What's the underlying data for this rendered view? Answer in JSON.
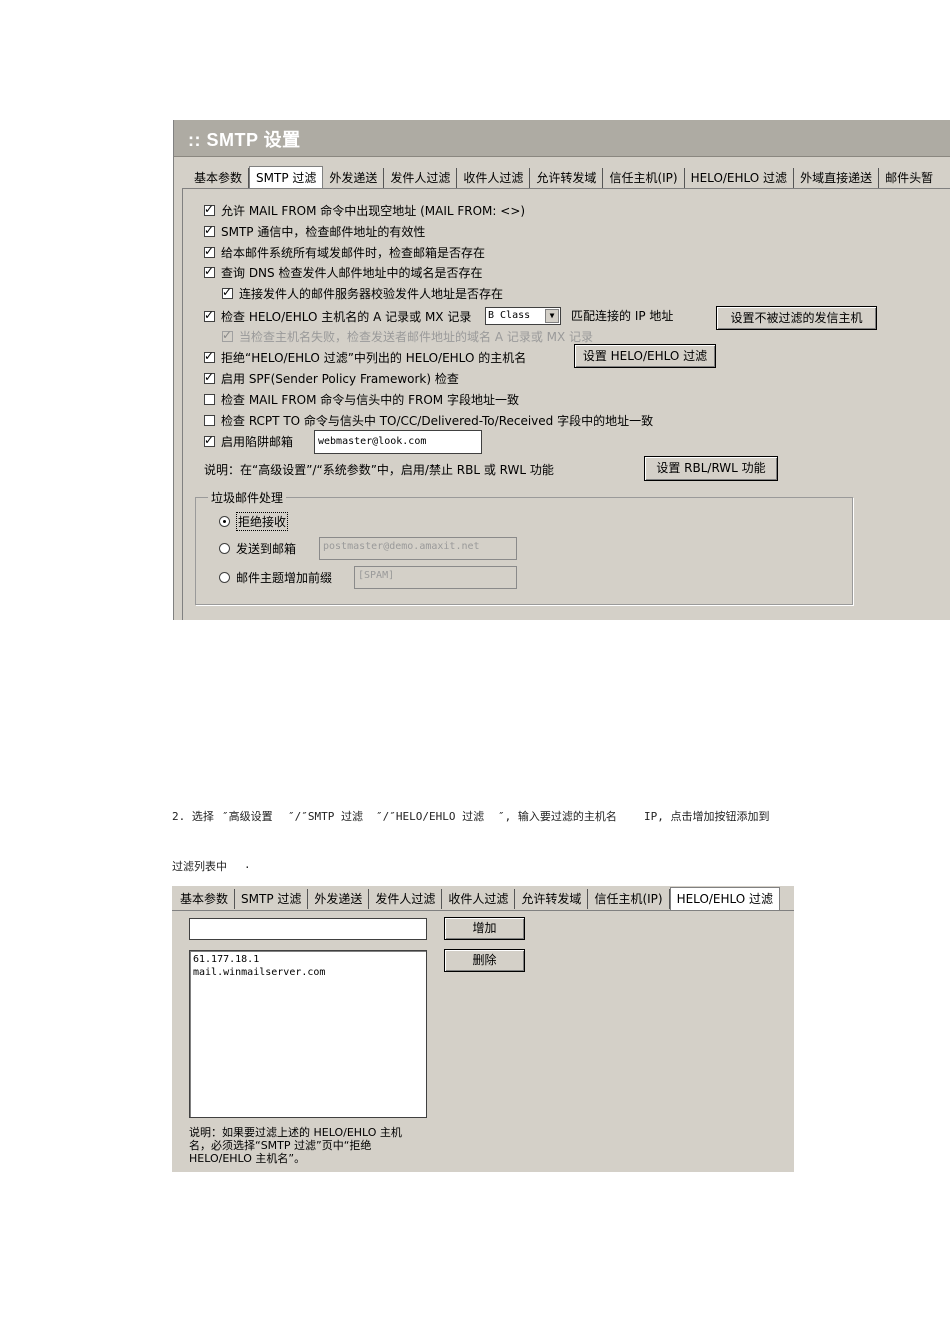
{
  "panel1": {
    "title": ":: SMTP 设置",
    "tabs": [
      "基本参数",
      "SMTP 过滤",
      "外发递送",
      "发件人过滤",
      "收件人过滤",
      "允许转发域",
      "信任主机(IP)",
      "HELO/EHLO 过滤",
      "外域直接递送",
      "邮件头暂"
    ],
    "active_tab": 1,
    "options": [
      {
        "label": "允许 MAIL FROM 命令中出现空地址 (MAIL FROM: <>)",
        "checked": true
      },
      {
        "label": "SMTP 通信中，检查邮件地址的有效性",
        "checked": true
      },
      {
        "label": "给本邮件系统所有域发邮件时，检查邮箱是否存在",
        "checked": true
      },
      {
        "label": "查询 DNS 检查发件人邮件地址中的域名是否存在",
        "checked": true
      },
      {
        "label": "连接发件人的邮件服务器校验发件人地址是否存在",
        "checked": true
      },
      {
        "label": "检查 HELO/EHLO 主机名的 A 记录或 MX 记录",
        "checked": true
      },
      {
        "label": "当检查主机名失败，检查发送者邮件地址的域名 A 记录或 MX 记录",
        "checked": true,
        "disabled": true
      },
      {
        "label": "拒绝“HELO/EHLO 过滤”中列出的 HELO/EHLO 的主机名",
        "checked": true
      },
      {
        "label": "启用 SPF(Sender Policy Framework) 检查",
        "checked": true
      },
      {
        "label": "检查 MAIL FROM 命令与信头中的 FROM 字段地址一致",
        "checked": false
      },
      {
        "label": "检查 RCPT TO 命令与信头中 TO/CC/Delivered-To/Received 字段中的地址一致",
        "checked": false
      },
      {
        "label": "启用陷阱邮箱",
        "checked": true
      }
    ],
    "class_select": "B Class",
    "match_ip_label": "匹配连接的 IP 地址",
    "btn_no_filter_hosts": "设置不被过滤的发信主机",
    "btn_helo_filter": "设置 HELO/EHLO 过滤",
    "trap_mailbox_value": "webmaster@look.com",
    "note": "说明：在“高级设置”/“系统参数”中，启用/禁止 RBL 或 RWL 功能",
    "btn_rbl": "设置 RBL/RWL 功能",
    "spam_group": {
      "legend": "垃圾邮件处理",
      "options": [
        {
          "label": "拒绝接收",
          "selected": true
        },
        {
          "label": "发送到邮箱",
          "selected": false
        },
        {
          "label": "邮件主题增加前缀",
          "selected": false
        }
      ],
      "mailbox_value": "postmaster@demo.amaxit.net",
      "prefix_value": "[SPAM]"
    }
  },
  "paragraph": {
    "line1_parts": [
      "2. 选择",
      "″高级设置",
      "″/″SMTP 过滤",
      "″/″HELO/EHLO 过滤",
      "″, 输入要过滤的主机名",
      "IP, 点击增加按钮添加到"
    ],
    "line2_parts": [
      "过滤列表中",
      "."
    ]
  },
  "panel2": {
    "tabs": [
      "基本参数",
      "SMTP 过滤",
      "外发递送",
      "发件人过滤",
      "收件人过滤",
      "允许转发域",
      "信任主机(IP)",
      "HELO/EHLO 过滤"
    ],
    "active_tab": 7,
    "input_value": "",
    "list_items": [
      "61.177.18.1",
      "mail.winmailserver.com"
    ],
    "btn_add": "增加",
    "btn_delete": "删除",
    "note_lines": [
      "说明：如果要过滤上述的 HELO/EHLO 主机",
      "名，必须选择“SMTP 过滤”页中“拒绝",
      "HELO/EHLO 主机名”。"
    ]
  }
}
